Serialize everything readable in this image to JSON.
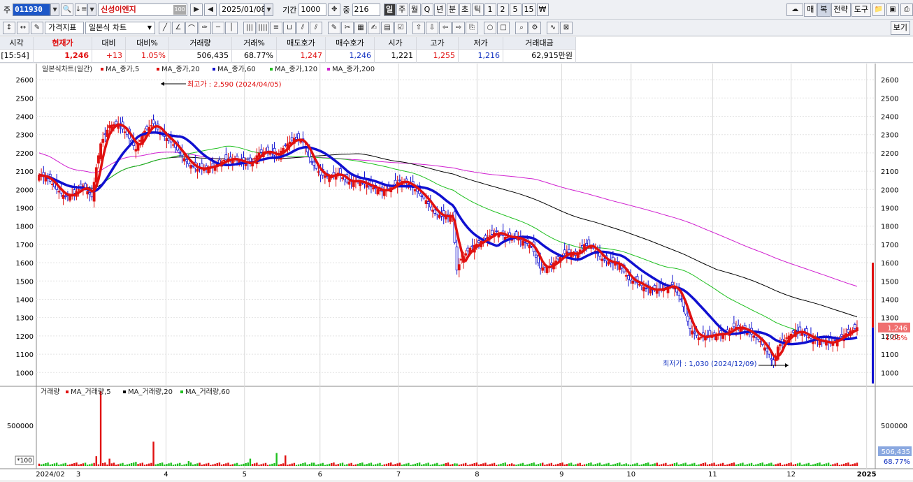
{
  "toolbar": {
    "market_label": "주",
    "code": "011930",
    "stock_name": "신성이엔지",
    "badge": "100",
    "date": "2025/01/08",
    "period_label": "기간",
    "period_value": "1000",
    "overlap_label": "중",
    "overlap_value": "216",
    "period_buttons": [
      "일",
      "주",
      "월",
      "Q",
      "년",
      "분",
      "초",
      "틱",
      "1",
      "2",
      "5",
      "15",
      "₩"
    ],
    "right_buttons": [
      "매",
      "복",
      "전략",
      "도구"
    ],
    "indicator_label": "가격지표",
    "chart_type_label": "일본식 차트",
    "view_label": "보기"
  },
  "quote": {
    "headers": [
      "시각",
      "현재가",
      "대비",
      "대비%",
      "거래량",
      "거래%",
      "매도호가",
      "매수호가",
      "시가",
      "고가",
      "저가",
      "거래대금"
    ],
    "values": [
      "[15:54]",
      "1,246",
      "+13",
      "1.05%",
      "506,435",
      "68.77%",
      "1,247",
      "1,246",
      "1,221",
      "1,255",
      "1,216",
      "62,915만원"
    ]
  },
  "price_panel": {
    "legend_title": "일본식차트(일간)",
    "legend_items": [
      {
        "name": "MA_종가,5",
        "color": "#e01010"
      },
      {
        "name": "MA_종가,20",
        "color": "#e01010"
      },
      {
        "name": "MA_종가,60",
        "color": "#1010d0"
      },
      {
        "name": "MA_종가,120",
        "color": "#20c020"
      },
      {
        "name": "MA_종가,200",
        "color": "#d020d0"
      }
    ],
    "high_annotation": "최고가 : 2,590 (2024/04/05)",
    "low_annotation": "최저가 : 1,030 (2024/12/09)",
    "current_price_label": "1,246",
    "current_pct_label": "1.05%"
  },
  "volume_panel": {
    "legend_title": "거래량",
    "legend_items": [
      {
        "name": "MA_거래량,5",
        "color": "#e01010"
      },
      {
        "name": "MA_거래량,20",
        "color": "#000000"
      },
      {
        "name": "MA_거래량,60",
        "color": "#20c020"
      }
    ],
    "scale_label": "*100",
    "current_volume_label": "506,435",
    "current_pct_label": "68.77%"
  },
  "chart_data": {
    "type": "candlestick",
    "y_ticks": [
      1000,
      1100,
      1200,
      1300,
      1400,
      1500,
      1600,
      1700,
      1800,
      1900,
      2000,
      2100,
      2200,
      2300,
      2400,
      2500,
      2600
    ],
    "ylim": [
      940,
      2650
    ],
    "volume_ticks": [
      500000
    ],
    "volume_ylim": [
      0,
      950000
    ],
    "x_ticks": [
      "2024/02",
      "3",
      "4",
      "5",
      "6",
      "7",
      "8",
      "9",
      "10",
      "11",
      "12",
      "2025"
    ],
    "close_series": [
      [
        0,
        2080
      ],
      [
        4,
        2060
      ],
      [
        8,
        2000
      ],
      [
        12,
        1960
      ],
      [
        16,
        1980
      ],
      [
        20,
        2020
      ],
      [
        24,
        1960
      ],
      [
        26,
        2120
      ],
      [
        28,
        2250
      ],
      [
        32,
        2350
      ],
      [
        36,
        2360
      ],
      [
        40,
        2300
      ],
      [
        44,
        2220
      ],
      [
        48,
        2320
      ],
      [
        52,
        2360
      ],
      [
        56,
        2300
      ],
      [
        60,
        2260
      ],
      [
        64,
        2200
      ],
      [
        68,
        2140
      ],
      [
        72,
        2110
      ],
      [
        76,
        2120
      ],
      [
        80,
        2130
      ],
      [
        84,
        2160
      ],
      [
        88,
        2170
      ],
      [
        92,
        2150
      ],
      [
        96,
        2140
      ],
      [
        100,
        2200
      ],
      [
        104,
        2210
      ],
      [
        108,
        2180
      ],
      [
        112,
        2240
      ],
      [
        116,
        2280
      ],
      [
        120,
        2260
      ],
      [
        124,
        2150
      ],
      [
        128,
        2080
      ],
      [
        132,
        2070
      ],
      [
        136,
        2090
      ],
      [
        140,
        2040
      ],
      [
        144,
        2050
      ],
      [
        148,
        2030
      ],
      [
        152,
        2010
      ],
      [
        156,
        1990
      ],
      [
        160,
        2010
      ],
      [
        164,
        2050
      ],
      [
        168,
        2030
      ],
      [
        172,
        1990
      ],
      [
        176,
        1940
      ],
      [
        180,
        1870
      ],
      [
        184,
        1850
      ],
      [
        188,
        1860
      ],
      [
        190,
        1560
      ],
      [
        192,
        1620
      ],
      [
        196,
        1680
      ],
      [
        200,
        1710
      ],
      [
        204,
        1740
      ],
      [
        208,
        1770
      ],
      [
        212,
        1740
      ],
      [
        216,
        1740
      ],
      [
        220,
        1720
      ],
      [
        224,
        1690
      ],
      [
        228,
        1570
      ],
      [
        232,
        1580
      ],
      [
        236,
        1620
      ],
      [
        240,
        1660
      ],
      [
        244,
        1640
      ],
      [
        248,
        1700
      ],
      [
        252,
        1680
      ],
      [
        256,
        1620
      ],
      [
        260,
        1600
      ],
      [
        264,
        1590
      ],
      [
        268,
        1510
      ],
      [
        272,
        1490
      ],
      [
        276,
        1460
      ],
      [
        280,
        1450
      ],
      [
        284,
        1460
      ],
      [
        288,
        1480
      ],
      [
        292,
        1400
      ],
      [
        296,
        1240
      ],
      [
        300,
        1190
      ],
      [
        304,
        1200
      ],
      [
        308,
        1210
      ],
      [
        312,
        1210
      ],
      [
        316,
        1250
      ],
      [
        320,
        1240
      ],
      [
        324,
        1210
      ],
      [
        328,
        1170
      ],
      [
        332,
        1100
      ],
      [
        334,
        1040
      ],
      [
        336,
        1140
      ],
      [
        340,
        1190
      ],
      [
        344,
        1230
      ],
      [
        348,
        1210
      ],
      [
        352,
        1180
      ],
      [
        356,
        1170
      ],
      [
        360,
        1160
      ],
      [
        364,
        1190
      ],
      [
        368,
        1220
      ],
      [
        372,
        1246
      ]
    ],
    "volume_series": [
      [
        0,
        28000
      ],
      [
        26,
        120000
      ],
      [
        28,
        920000
      ],
      [
        32,
        90000
      ],
      [
        44,
        50000
      ],
      [
        52,
        300000
      ],
      [
        68,
        60000
      ],
      [
        96,
        90000
      ],
      [
        108,
        160000
      ],
      [
        112,
        130000
      ],
      [
        124,
        40000
      ],
      [
        190,
        30000
      ],
      [
        216,
        20000
      ],
      [
        268,
        20000
      ],
      [
        296,
        20000
      ],
      [
        372,
        40000
      ]
    ]
  }
}
